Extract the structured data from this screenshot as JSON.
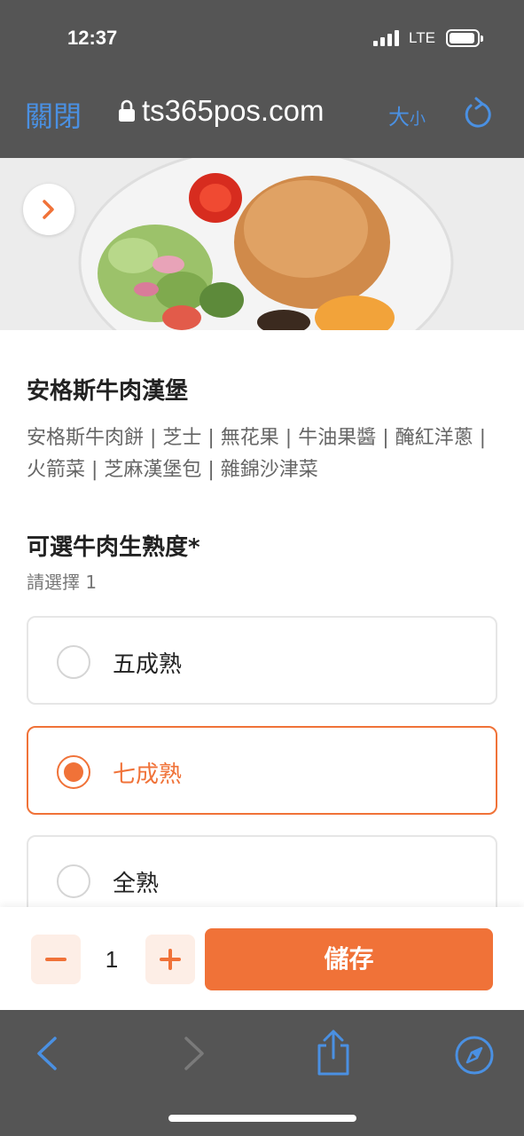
{
  "status_bar": {
    "time": "12:37",
    "network": "LTE"
  },
  "browser": {
    "close_label": "關閉",
    "url": "ts365pos.com",
    "size_label_large": "大",
    "size_label_small": "小"
  },
  "item": {
    "title": "安格斯牛肉漢堡",
    "description": "安格斯牛肉餅 | 芝士 | 無花果 | 牛油果醬 | 醃紅洋蔥 | 火箭菜 | 芝麻漢堡包 | 雜錦沙津菜"
  },
  "options_group": {
    "title": "可選牛肉生熟度*",
    "hint": "請選擇 1",
    "options": [
      {
        "label": "五成熟",
        "selected": false
      },
      {
        "label": "七成熟",
        "selected": true
      },
      {
        "label": "全熟",
        "selected": false
      }
    ]
  },
  "action_bar": {
    "quantity": "1",
    "save_label": "儲存"
  },
  "colors": {
    "accent": "#f07238",
    "browser_blue": "#4a90e2",
    "chrome_gray": "#555555"
  }
}
